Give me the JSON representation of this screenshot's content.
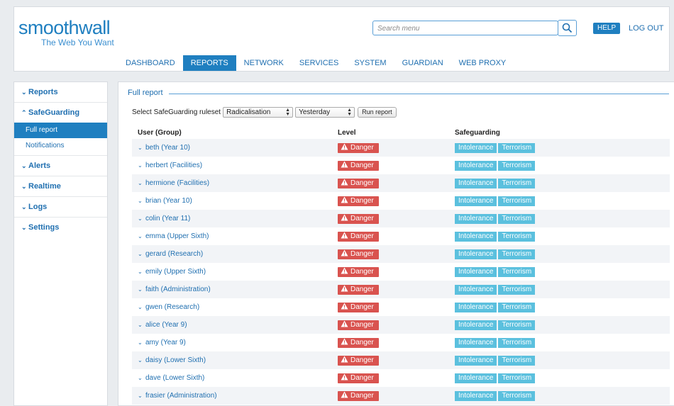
{
  "header": {
    "logo": "smoothwall",
    "tagline": "The Web You Want",
    "search_placeholder": "Search menu",
    "help_label": "HELP",
    "logout_label": "LOG OUT"
  },
  "nav": [
    {
      "label": "DASHBOARD",
      "active": false
    },
    {
      "label": "REPORTS",
      "active": true
    },
    {
      "label": "NETWORK",
      "active": false
    },
    {
      "label": "SERVICES",
      "active": false
    },
    {
      "label": "SYSTEM",
      "active": false
    },
    {
      "label": "GUARDIAN",
      "active": false
    },
    {
      "label": "WEB PROXY",
      "active": false
    }
  ],
  "sidebar": {
    "reports": "Reports",
    "safeguarding": "SafeGuarding",
    "sub_items": [
      {
        "label": "Full report",
        "active": true
      },
      {
        "label": "Notifications",
        "active": false
      }
    ],
    "alerts": "Alerts",
    "realtime": "Realtime",
    "logs": "Logs",
    "settings": "Settings"
  },
  "main": {
    "title": "Full report",
    "ruleset_label": "Select SafeGuarding ruleset",
    "ruleset_value": "Radicalisation",
    "period_value": "Yesterday",
    "run_label": "Run report",
    "columns": [
      "User (Group)",
      "Level",
      "Safeguarding"
    ],
    "rows": [
      {
        "user": "beth (Year 10)",
        "level": "Danger",
        "tags": [
          "Intolerance",
          "Terrorism"
        ]
      },
      {
        "user": "herbert (Facilities)",
        "level": "Danger",
        "tags": [
          "Intolerance",
          "Terrorism"
        ]
      },
      {
        "user": "hermione (Facilities)",
        "level": "Danger",
        "tags": [
          "Intolerance",
          "Terrorism"
        ]
      },
      {
        "user": "brian (Year 10)",
        "level": "Danger",
        "tags": [
          "Intolerance",
          "Terrorism"
        ]
      },
      {
        "user": "colin (Year 11)",
        "level": "Danger",
        "tags": [
          "Intolerance",
          "Terrorism"
        ]
      },
      {
        "user": "emma (Upper Sixth)",
        "level": "Danger",
        "tags": [
          "Intolerance",
          "Terrorism"
        ]
      },
      {
        "user": "gerard (Research)",
        "level": "Danger",
        "tags": [
          "Intolerance",
          "Terrorism"
        ]
      },
      {
        "user": "emily (Upper Sixth)",
        "level": "Danger",
        "tags": [
          "Intolerance",
          "Terrorism"
        ]
      },
      {
        "user": "faith (Administration)",
        "level": "Danger",
        "tags": [
          "Intolerance",
          "Terrorism"
        ]
      },
      {
        "user": "gwen (Research)",
        "level": "Danger",
        "tags": [
          "Intolerance",
          "Terrorism"
        ]
      },
      {
        "user": "alice (Year 9)",
        "level": "Danger",
        "tags": [
          "Intolerance",
          "Terrorism"
        ]
      },
      {
        "user": "amy (Year 9)",
        "level": "Danger",
        "tags": [
          "Intolerance",
          "Terrorism"
        ]
      },
      {
        "user": "daisy (Lower Sixth)",
        "level": "Danger",
        "tags": [
          "Intolerance",
          "Terrorism"
        ]
      },
      {
        "user": "dave (Lower Sixth)",
        "level": "Danger",
        "tags": [
          "Intolerance",
          "Terrorism"
        ]
      },
      {
        "user": "frasier (Administration)",
        "level": "Danger",
        "tags": [
          "Intolerance",
          "Terrorism"
        ]
      }
    ]
  },
  "colors": {
    "brand": "#1f7fc0",
    "danger": "#d9534f",
    "tag": "#5bc0de"
  }
}
